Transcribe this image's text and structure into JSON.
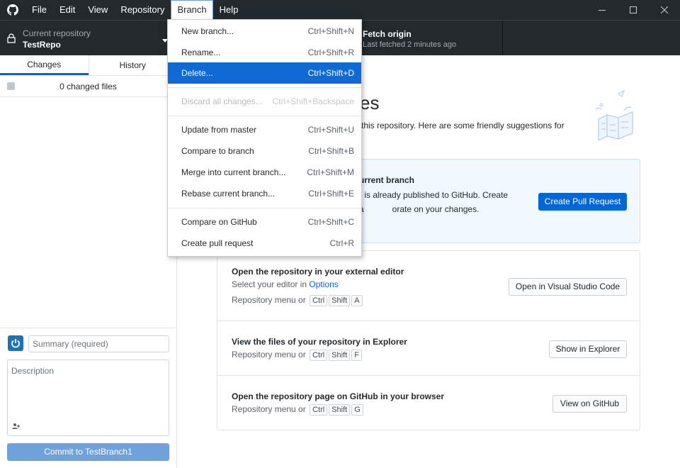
{
  "menubar": {
    "items": [
      "File",
      "Edit",
      "View",
      "Repository",
      "Branch",
      "Help"
    ],
    "active": "Branch"
  },
  "toolbar": {
    "repo_label": "Current repository",
    "repo_value": "TestRepo",
    "fetch_label": "Fetch origin",
    "fetch_sub": "Last fetched 2 minutes ago"
  },
  "sidebar": {
    "tabs": [
      "Changes",
      "History"
    ],
    "changed_files": "0 changed files",
    "summary_placeholder": "Summary (required)",
    "description_placeholder": "Description",
    "commit_button": "Commit to TestBranch1"
  },
  "main": {
    "heading_fragment": "es",
    "intro": "this repository. Here are some friendly suggestions for",
    "publish_card": {
      "title": "urrent branch",
      "description": ") is already published to GitHub. Create a            orate on your changes.",
      "button": "Create Pull Request"
    },
    "rows": [
      {
        "title": "Open the repository in your external editor",
        "subtitle_prefix": "Select your editor in",
        "subtitle_link": "Options",
        "shortcut_prefix": "Repository menu or",
        "keys": [
          "Ctrl",
          "Shift",
          "A"
        ],
        "button": "Open in Visual Studio Code"
      },
      {
        "title": "View the files of your repository in Explorer",
        "shortcut_prefix": "Repository menu or",
        "keys": [
          "Ctrl",
          "Shift",
          "F"
        ],
        "button": "Show in Explorer"
      },
      {
        "title": "Open the repository page on GitHub in your browser",
        "shortcut_prefix": "Repository menu or",
        "keys": [
          "Ctrl",
          "Shift",
          "G"
        ],
        "button": "View on GitHub"
      }
    ]
  },
  "branch_menu": {
    "items": [
      {
        "label": "New branch...",
        "shortcut": "Ctrl+Shift+N"
      },
      {
        "label": "Rename...",
        "shortcut": "Ctrl+Shift+R"
      },
      {
        "label": "Delete...",
        "shortcut": "Ctrl+Shift+D",
        "highlighted": true
      },
      {
        "label": "Discard all changes...",
        "shortcut": "Ctrl+Shift+Backspace",
        "disabled": true
      },
      {
        "label": "Update from master",
        "shortcut": "Ctrl+Shift+U"
      },
      {
        "label": "Compare to branch",
        "shortcut": "Ctrl+Shift+B"
      },
      {
        "label": "Merge into current branch...",
        "shortcut": "Ctrl+Shift+M"
      },
      {
        "label": "Rebase current branch...",
        "shortcut": "Ctrl+Shift+E"
      },
      {
        "label": "Compare on GitHub",
        "shortcut": "Ctrl+Shift+C"
      },
      {
        "label": "Create pull request",
        "shortcut": "Ctrl+R"
      }
    ]
  },
  "colors": {
    "titlebar": "#24292e",
    "accent": "#0366d6",
    "menu_highlight": "#0f6ad6",
    "commit_button": "#6fa1db"
  }
}
